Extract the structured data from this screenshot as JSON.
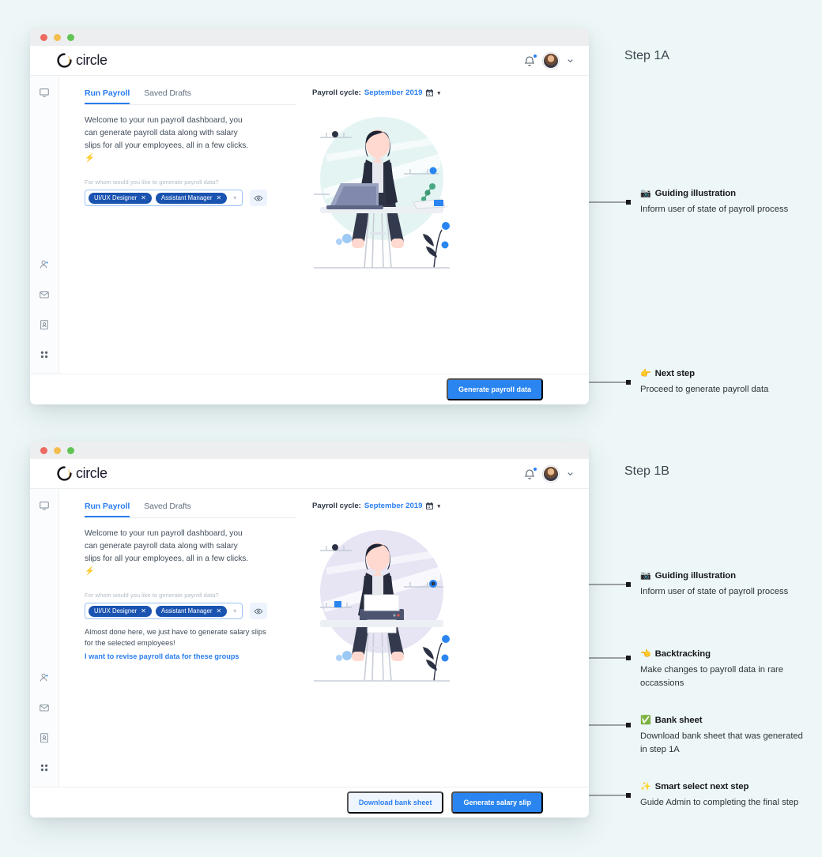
{
  "background_color": "#eef7f7",
  "accent_blue": "#2a85f0",
  "pill_blue": "#1a53b0",
  "app": {
    "logo_text": "circle",
    "logo_icon": "circle-logo-icon",
    "notification_icon": "bell-icon",
    "avatar_icon": "user-avatar",
    "account_chevron_icon": "chevron-down-icon",
    "sidebar": [
      {
        "icon": "monitor-icon",
        "name": "sidebar-item-dashboard"
      },
      {
        "icon": "add-user-icon",
        "name": "sidebar-item-employees"
      },
      {
        "icon": "envelope-icon",
        "name": "sidebar-item-messages"
      },
      {
        "icon": "id-card-icon",
        "name": "sidebar-item-documents"
      },
      {
        "icon": "grid-apps-icon",
        "name": "sidebar-item-apps"
      }
    ],
    "tabs": [
      {
        "label": "Run Payroll",
        "active": true
      },
      {
        "label": "Saved Drafts",
        "active": false
      }
    ],
    "welcome_text": "Welcome to your run payroll dashboard, you can generate payroll data along with salary slips for all your employees, all in a few clicks. ⚡",
    "field_label": "For whom would you like to generate payroll data?",
    "pills": [
      {
        "label": "UI/UX Designer",
        "remove_icon": "close-icon"
      },
      {
        "label": "Assistant Manager",
        "remove_icon": "close-icon"
      }
    ],
    "select_chevron_icon": "chevron-down-icon",
    "preview_icon": "eye-icon",
    "cycle_label": "Payroll cycle:",
    "cycle_value": "September 2019",
    "cycle_calendar_icon": "calendar-icon",
    "cycle_caret_icon": "caret-down-icon"
  },
  "step_1a": {
    "title": "Step 1A",
    "illustration_name": "woman-with-laptop-illustration",
    "illustration_bg": "#e4f4f2",
    "buttons": [
      {
        "label": "Generate payroll data",
        "style": "primary",
        "name": "generate-payroll-data-button"
      }
    ],
    "annotations": [
      {
        "emoji": "📷",
        "emoji_name": "camera-icon",
        "title": "Guiding illustration",
        "body": "Inform user of state of payroll process"
      },
      {
        "emoji": "👉",
        "emoji_name": "pointing-hand-icon",
        "title": "Next step",
        "body": "Proceed to generate payroll data"
      }
    ]
  },
  "step_1b": {
    "title": "Step 1B",
    "illustration_name": "woman-with-printer-illustration",
    "illustration_bg": "#e7e4f4",
    "note_text": "Almost done here, we just have to generate salary slips for the selected employees!",
    "revise_link": "I want to revise payroll data for these groups",
    "buttons": [
      {
        "label": "Download bank sheet",
        "style": "ghost",
        "name": "download-bank-sheet-button"
      },
      {
        "label": "Generate salary slip",
        "style": "primary",
        "name": "generate-salary-slip-button"
      }
    ],
    "annotations": [
      {
        "emoji": "📷",
        "emoji_name": "camera-icon",
        "title": "Guiding illustration",
        "body": "Inform user of state of payroll process"
      },
      {
        "emoji": "👈",
        "emoji_name": "pointing-back-hand-icon",
        "title": "Backtracking",
        "body": "Make changes to payroll data in rare occassions"
      },
      {
        "emoji": "✅",
        "emoji_name": "check-mark-icon",
        "title": "Bank sheet",
        "body": "Download bank sheet that was generated in step 1A"
      },
      {
        "emoji": "✨",
        "emoji_name": "sparkles-icon",
        "title": "Smart select next step",
        "body": "Guide Admin to completing the final step"
      }
    ]
  }
}
